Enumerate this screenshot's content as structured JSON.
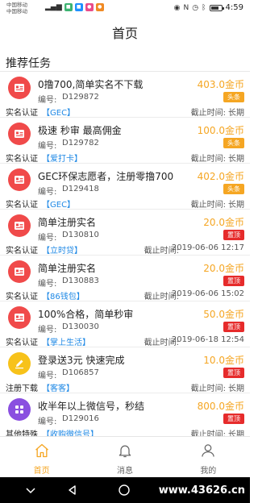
{
  "status_bar": {
    "carrier_1": "中国移动",
    "carrier_2": "中国移动",
    "time": "4:59"
  },
  "header": {
    "title": "首页"
  },
  "section": {
    "title": "推荐任务"
  },
  "tasks": [
    {
      "title": "0撸700,简单实名不下载",
      "code_label": "编号:",
      "code": "D129872",
      "reward": "403.0金币",
      "tag": "头条",
      "tag_color": "orange",
      "category": "实名认证",
      "sub": "【GEC】",
      "deadline_label": "截止时间:",
      "deadline": "长期",
      "icon_color": "#f04a4a",
      "icon": "id-card-icon"
    },
    {
      "title": "极速 秒审 最高佣金",
      "code_label": "编号:",
      "code": "D129782",
      "reward": "100.0金币",
      "tag": "头条",
      "tag_color": "orange",
      "category": "实名认证",
      "sub": "【爱打卡】",
      "deadline_label": "截止时间:",
      "deadline": "长期",
      "icon_color": "#f04a4a",
      "icon": "id-card-icon"
    },
    {
      "title": "GEC环保志愿者，注册零撸700",
      "code_label": "编号:",
      "code": "D129418",
      "reward": "402.0金币",
      "tag": "头条",
      "tag_color": "orange",
      "category": "实名认证",
      "sub": "【GEC】",
      "deadline_label": "截止时间:",
      "deadline": "长期",
      "icon_color": "#f04a4a",
      "icon": "id-card-icon"
    },
    {
      "title": "简单注册实名",
      "code_label": "编号:",
      "code": "D130810",
      "reward": "20.0金币",
      "tag": "置顶",
      "tag_color": "red",
      "category": "实名认证",
      "sub": "【立时贷】",
      "deadline_label": "截止时间:",
      "deadline": "2019-06-06 12:17",
      "icon_color": "#f04a4a",
      "icon": "id-card-icon"
    },
    {
      "title": "简单注册实名",
      "code_label": "编号:",
      "code": "D130883",
      "reward": "20.0金币",
      "tag": "置顶",
      "tag_color": "red",
      "category": "实名认证",
      "sub": "【86钱包】",
      "deadline_label": "截止时间:",
      "deadline": "2019-06-06 15:02",
      "icon_color": "#f04a4a",
      "icon": "id-card-icon"
    },
    {
      "title": "100%合格，简单秒审",
      "code_label": "编号:",
      "code": "D130030",
      "reward": "50.0金币",
      "tag": "置顶",
      "tag_color": "red",
      "category": "实名认证",
      "sub": "【掌上生活】",
      "deadline_label": "截止时间:",
      "deadline": "2019-06-18 12:54",
      "icon_color": "#f04a4a",
      "icon": "id-card-icon"
    },
    {
      "title": "登录送3元 快速完成",
      "code_label": "编号:",
      "code": "D106857",
      "reward": "10.0金币",
      "tag": "置顶",
      "tag_color": "red",
      "category": "注册下载",
      "sub": "【客客】",
      "deadline_label": "截止时间:",
      "deadline": "长期",
      "icon_color": "#f7c21a",
      "icon": "pencil-icon"
    },
    {
      "title": "收半年以上微信号，秒结",
      "code_label": "编号:",
      "code": "D129016",
      "reward": "800.0金币",
      "tag": "置顶",
      "tag_color": "red",
      "category": "其他特殊",
      "sub": "【收购微信号】",
      "deadline_label": "截止时间:",
      "deadline": "长期",
      "icon_color": "#8a4fe0",
      "icon": "grid-icon"
    }
  ],
  "tabbar": {
    "items": [
      {
        "label": "首页",
        "icon": "home-icon",
        "active": true
      },
      {
        "label": "消息",
        "icon": "bell-icon",
        "active": false
      },
      {
        "label": "我的",
        "icon": "user-icon",
        "active": false
      }
    ]
  },
  "watermark": "www.43626.cn",
  "colors": {
    "accent": "#f5a623",
    "red": "#e62b2b",
    "link": "#1e88e5"
  }
}
